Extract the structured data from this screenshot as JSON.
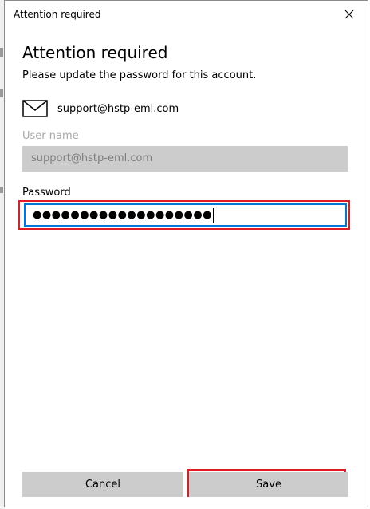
{
  "window": {
    "title": "Attention required"
  },
  "content": {
    "heading": "Attention required",
    "message": "Please update the password for this account.",
    "account_email": "support@hstp-eml.com"
  },
  "username": {
    "label": "User name",
    "value": "support@hstp-eml.com"
  },
  "password": {
    "label": "Password",
    "masked_value": "●●●●●●●●●●●●●●●●●●●"
  },
  "actions": {
    "cancel_label": "Cancel",
    "save_label": "Save"
  },
  "icons": {
    "account": "mail-icon",
    "close": "close-icon"
  },
  "colors": {
    "highlight": "#e01b24",
    "focus": "#0078d7",
    "button_bg": "#cccccc"
  }
}
